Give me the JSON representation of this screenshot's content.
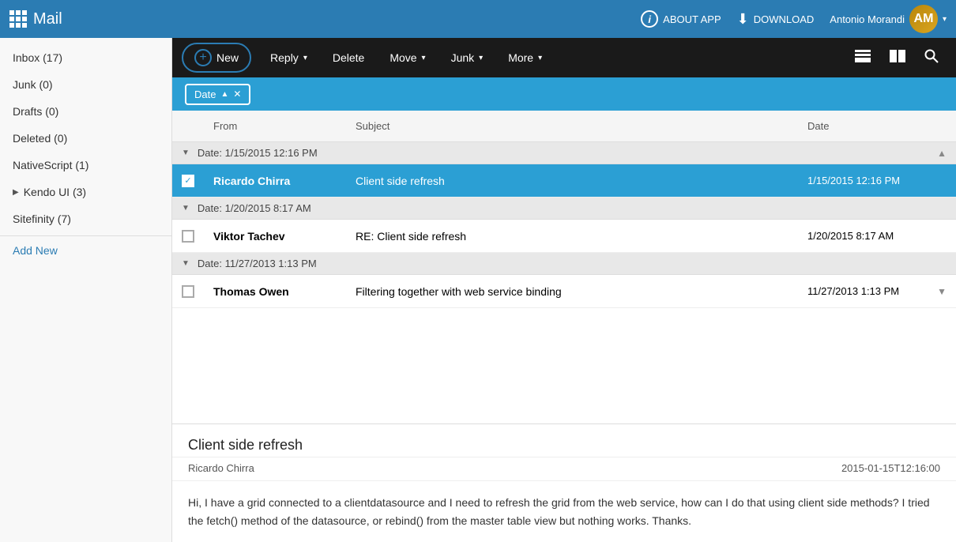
{
  "app": {
    "title": "Mail",
    "about_label": "ABOUT APP",
    "download_label": "DOWNLOAD",
    "username": "Antonio Morandi"
  },
  "toolbar": {
    "new_label": "New",
    "reply_label": "Reply",
    "delete_label": "Delete",
    "move_label": "Move",
    "junk_label": "Junk",
    "more_label": "More"
  },
  "filter": {
    "date_label": "Date"
  },
  "table": {
    "col_from": "From",
    "col_subject": "Subject",
    "col_date": "Date"
  },
  "email_groups": [
    {
      "date_header": "Date: 1/15/2015 12:16 PM",
      "emails": [
        {
          "sender": "Ricardo Chirra",
          "subject": "Client side refresh",
          "date": "1/15/2015 12:16 PM",
          "selected": true,
          "checked": true
        }
      ]
    },
    {
      "date_header": "Date: 1/20/2015 8:17 AM",
      "emails": [
        {
          "sender": "Viktor Tachev",
          "subject": "RE: Client side refresh",
          "date": "1/20/2015 8:17 AM",
          "selected": false,
          "checked": false
        }
      ]
    },
    {
      "date_header": "Date: 11/27/2013 1:13 PM",
      "emails": [
        {
          "sender": "Thomas Owen",
          "subject": "Filtering together with web service binding",
          "date": "11/27/2013 1:13 PM",
          "selected": false,
          "checked": false
        }
      ]
    }
  ],
  "preview": {
    "title": "Client side refresh",
    "from": "Ricardo Chirra",
    "date": "2015-01-15T12:16:00",
    "body": "Hi, I have a grid connected to a clientdatasource and I need to refresh the grid from the web service, how can I do that using client side methods? I tried the fetch() method of the datasource, or rebind() from the master table view but nothing works. Thanks."
  },
  "sidebar": {
    "items": [
      {
        "label": "Inbox (17)",
        "count": 17,
        "expandable": false
      },
      {
        "label": "Junk (0)",
        "count": 0,
        "expandable": false
      },
      {
        "label": "Drafts (0)",
        "count": 0,
        "expandable": false
      },
      {
        "label": "Deleted (0)",
        "count": 0,
        "expandable": false
      },
      {
        "label": "NativeScript (1)",
        "count": 1,
        "expandable": false
      },
      {
        "label": "Kendo UI (3)",
        "count": 3,
        "expandable": true
      },
      {
        "label": "Sitefinity (7)",
        "count": 7,
        "expandable": false
      }
    ],
    "add_new_label": "Add New"
  },
  "colors": {
    "accent": "#2b9fd4",
    "topbar": "#2b7cb3",
    "toolbar": "#1a1a1a",
    "selected_row": "#2b9fd4"
  }
}
